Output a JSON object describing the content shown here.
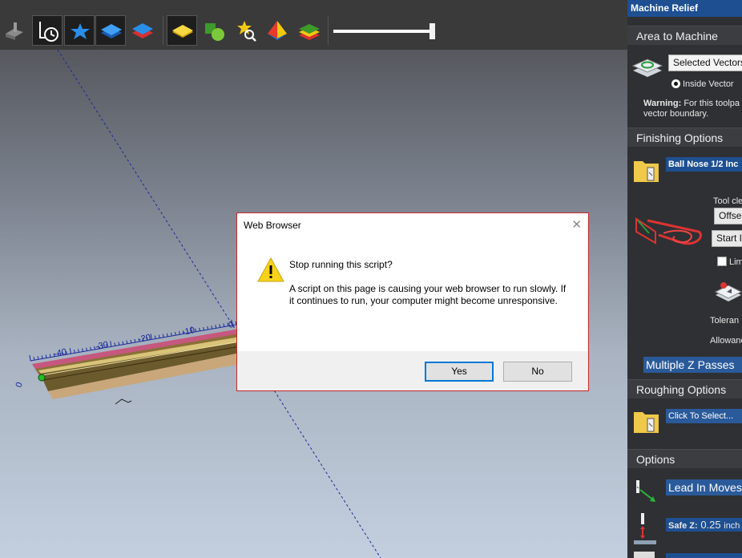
{
  "toolbar": {
    "buttons": [
      {
        "icon": "gray-tool-icon"
      },
      {
        "icon": "toolpath-clock-icon",
        "selected": true
      },
      {
        "icon": "blue-star-icon",
        "selected": true
      },
      {
        "icon": "blue-layers-icon",
        "selected": true
      },
      {
        "icon": "red-layers-icon"
      },
      {
        "icon": "yellow-diamond-icon",
        "selected": true
      },
      {
        "icon": "green-shapes-icon"
      },
      {
        "icon": "star-zoom-icon"
      },
      {
        "icon": "pyramid-icon"
      },
      {
        "icon": "multi-layer-icon"
      }
    ],
    "slider_value": 1.0
  },
  "viewport": {
    "ruler_labels": [
      "-40",
      "-30",
      "-20",
      "-10",
      "0"
    ],
    "side_label": "0"
  },
  "dialog": {
    "title": "Web Browser",
    "close": "✕",
    "heading": "Stop running this script?",
    "message": "A script on this page is causing your web browser to run slowly. If it continues to run, your computer might become unresponsive.",
    "yes": "Yes",
    "no": "No"
  },
  "panel": {
    "title": "Machine Relief",
    "area_section": "Area to Machine",
    "area_select": "Selected Vectors",
    "inside_vector": "Inside Vector",
    "warning_label": "Warning:",
    "warning_text": "For this toolpa",
    "warning_text2": "vector boundary.",
    "finishing_section": "Finishing Options",
    "finishing_tool": "Ball Nose 1/2 Inc",
    "tool_clear_label": "Tool cle",
    "offset_select": "Offse",
    "start_button": "Start I",
    "limit_label": "Lim",
    "tolerance_label": "Toleran",
    "allowance_label": "Allowanc",
    "multiple_z": "Multiple Z Passes",
    "roughing_section": "Roughing Options",
    "roughing_tool": "Click To Select...",
    "options_section": "Options",
    "lead_in": "Lead In Moves",
    "safe_z_label": "Safe Z:",
    "safe_z_value": "0.25",
    "safe_z_unit": "inch"
  },
  "colors": {
    "accent": "#1e4f91",
    "dialog_border": "#c8282a",
    "yes_focus": "#0078d7"
  }
}
